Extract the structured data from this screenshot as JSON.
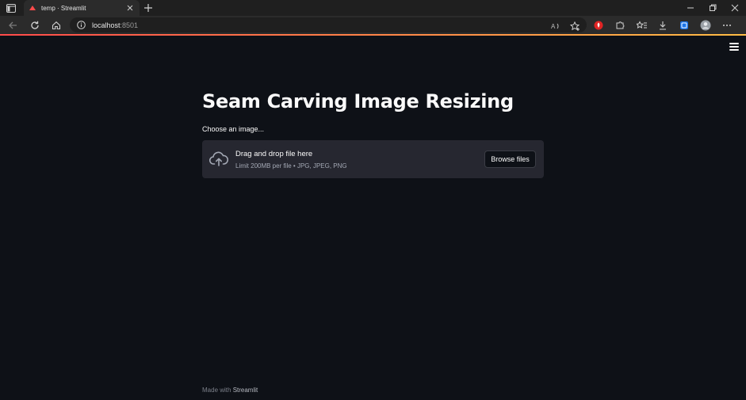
{
  "browser": {
    "tab_title": "temp · Streamlit",
    "url_host": "localhost",
    "url_port": ":8501",
    "icons": [
      "tab-actions-icon",
      "streamlit-favicon",
      "close-icon",
      "plus-icon",
      "minimize-icon",
      "restore-icon",
      "close-icon",
      "back-icon",
      "refresh-icon",
      "home-icon",
      "info-icon",
      "read-aloud-icon",
      "add-favorite-icon",
      "extension-icon",
      "extensions-icon",
      "favorites-icon",
      "downloads-icon",
      "collections-icon",
      "profile-avatar",
      "more-icon"
    ]
  },
  "app": {
    "title": "Seam Carving Image Resizing",
    "uploader_label": "Choose an image...",
    "dropzone_title": "Drag and drop file here",
    "dropzone_limit": "Limit 200MB per file • JPG, JPEG, PNG",
    "browse_button": "Browse files",
    "footer_prefix": "Made with ",
    "footer_brand": "Streamlit"
  },
  "colors": {
    "background": "#0e1117",
    "dropzone": "#262730",
    "accent_start": "#ff4b4b",
    "accent_end": "#ffbd45",
    "text": "#fafafa"
  }
}
